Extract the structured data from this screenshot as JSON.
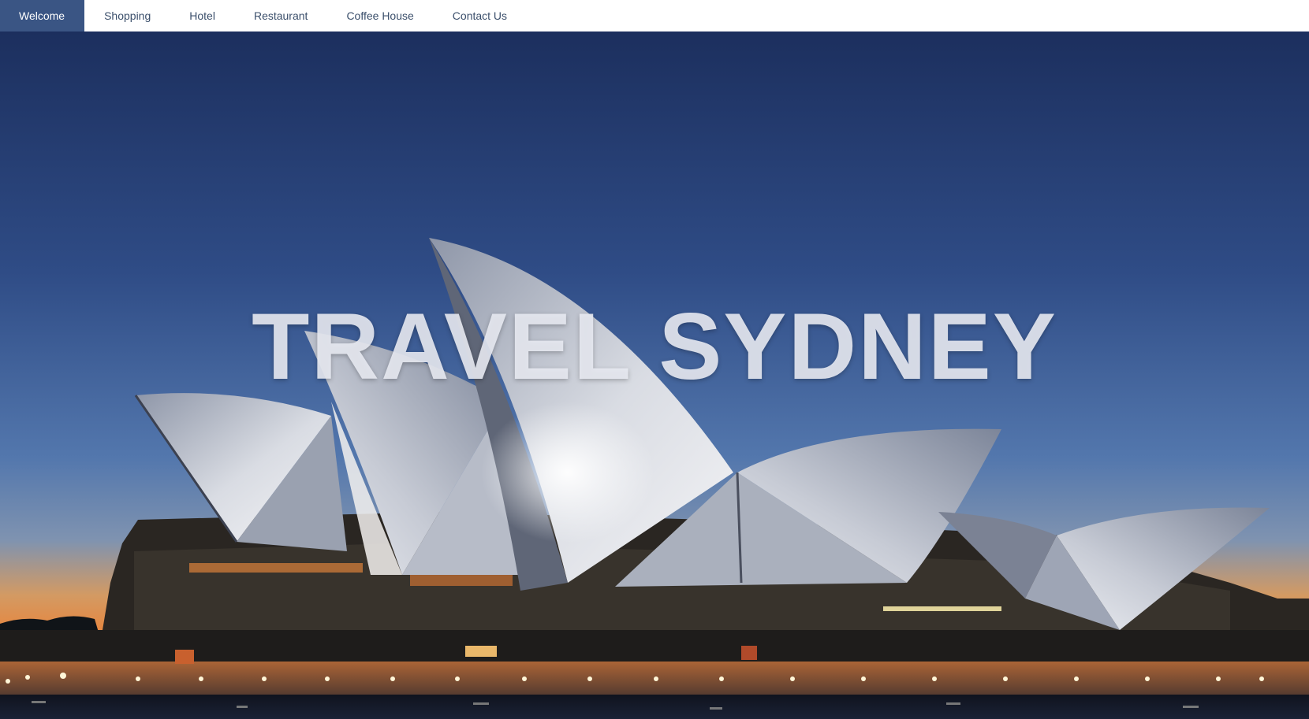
{
  "nav": {
    "items": [
      {
        "label": "Welcome",
        "active": true
      },
      {
        "label": "Shopping",
        "active": false
      },
      {
        "label": "Hotel",
        "active": false
      },
      {
        "label": "Restaurant",
        "active": false
      },
      {
        "label": "Coffee House",
        "active": false
      },
      {
        "label": "Contact Us",
        "active": false
      }
    ]
  },
  "hero": {
    "title": "TRAVEL SYDNEY",
    "image_subject": "Sydney Opera House at dusk"
  },
  "colors": {
    "nav_active_bg": "#3a5584",
    "nav_text": "#3b4f6b",
    "sky_top": "#1e3466",
    "sky_mid": "#46689f",
    "sky_horizon": "#e6883e"
  }
}
